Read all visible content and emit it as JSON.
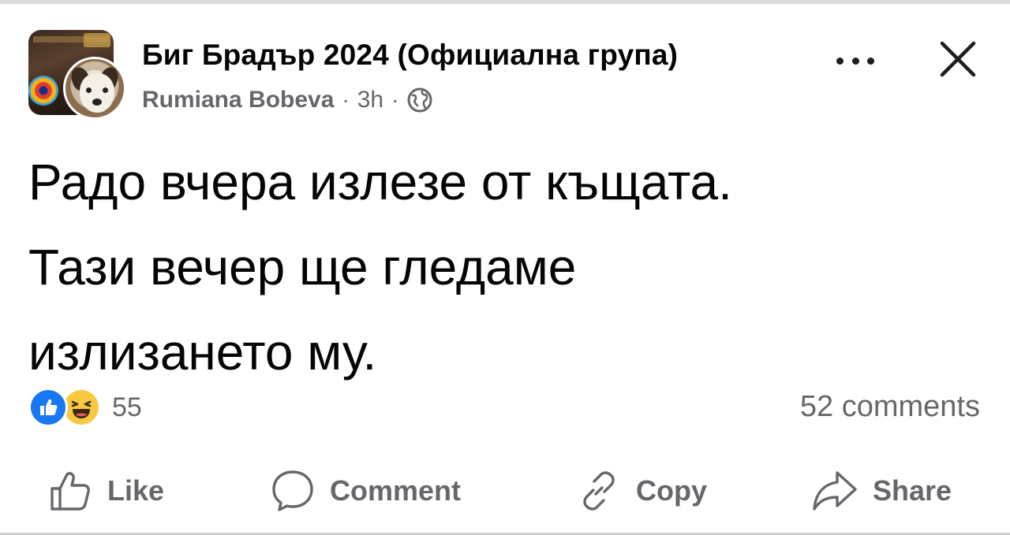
{
  "header": {
    "group_name": "Биг Брадър 2024 (Официална група)",
    "author": "Rumiana Bobeva",
    "separator": "·",
    "time": "3h",
    "audience_icon": "globe-icon",
    "more_icon": "more-horizontal-icon",
    "close_icon": "close-icon"
  },
  "post": {
    "lines": [
      "Радо вчера излезе от къщата.",
      "Тази вечер ще гледаме",
      "излизането му."
    ]
  },
  "reactions": {
    "icons": [
      "like-reaction-icon",
      "haha-reaction-icon"
    ],
    "count": "55",
    "comments": "52 comments"
  },
  "actions": [
    {
      "label": "Like",
      "icon": "thumbs-up-icon"
    },
    {
      "label": "Comment",
      "icon": "comment-bubble-icon"
    },
    {
      "label": "Copy",
      "icon": "link-icon"
    },
    {
      "label": "Share",
      "icon": "share-arrow-icon"
    }
  ],
  "colors": {
    "primary_text": "#050505",
    "secondary_text": "#65676b",
    "like_blue": "#1877f2",
    "haha_yellow": "#f7c940"
  }
}
